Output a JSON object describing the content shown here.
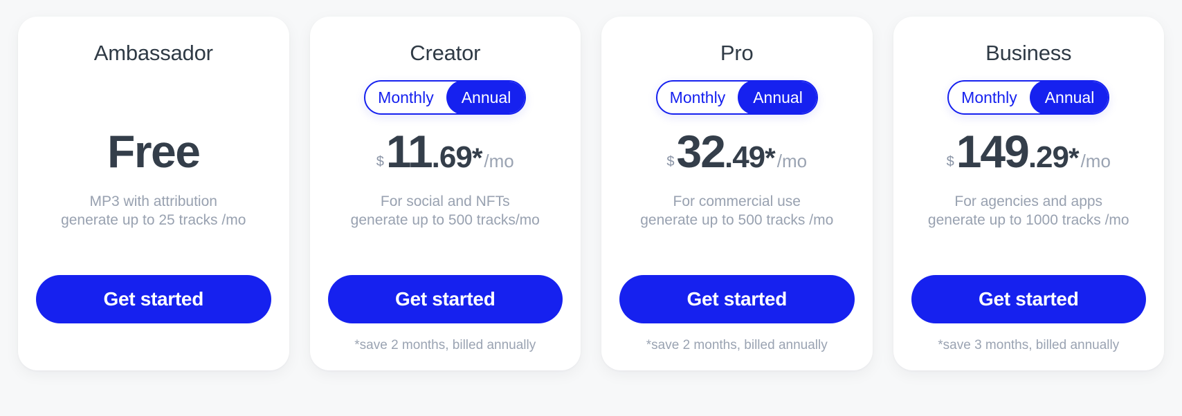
{
  "theme": {
    "page_background": "#f7f8f9",
    "card_background": "#ffffff",
    "accent": "#1621ef",
    "title_color": "#2f3a45",
    "price_color": "#343e4a",
    "muted_text": "#98a1b0"
  },
  "plans": [
    {
      "name": "Ambassador",
      "has_toggle": false,
      "price_free_label": "Free",
      "currency": "",
      "price_integer": "",
      "price_decimal": "",
      "price_star": "",
      "price_period": "",
      "desc_line1": "MP3 with attribution",
      "desc_line2": "generate up to 25 tracks /mo",
      "cta_label": "Get started",
      "footnote": ""
    },
    {
      "name": "Creator",
      "has_toggle": true,
      "toggle_monthly": "Monthly",
      "toggle_annual": "Annual",
      "toggle_selected": "Annual",
      "currency": "$",
      "price_integer": "11",
      "price_decimal": ".69",
      "price_star": "*",
      "price_period": "/mo",
      "desc_line1": "For social and NFTs",
      "desc_line2": "generate up to 500 tracks/mo",
      "cta_label": "Get started",
      "footnote": "*save 2 months, billed annually"
    },
    {
      "name": "Pro",
      "has_toggle": true,
      "toggle_monthly": "Monthly",
      "toggle_annual": "Annual",
      "toggle_selected": "Annual",
      "currency": "$",
      "price_integer": "32",
      "price_decimal": ".49",
      "price_star": "*",
      "price_period": "/mo",
      "desc_line1": "For commercial use",
      "desc_line2": "generate up to 500 tracks /mo",
      "cta_label": "Get started",
      "footnote": "*save 2 months, billed annually"
    },
    {
      "name": "Business",
      "has_toggle": true,
      "toggle_monthly": "Monthly",
      "toggle_annual": "Annual",
      "toggle_selected": "Annual",
      "currency": "$",
      "price_integer": "149",
      "price_decimal": ".29",
      "price_star": "*",
      "price_period": "/mo",
      "desc_line1": "For agencies and apps",
      "desc_line2": "generate up to 1000 tracks /mo",
      "cta_label": "Get started",
      "footnote": "*save 3 months, billed annually"
    }
  ]
}
